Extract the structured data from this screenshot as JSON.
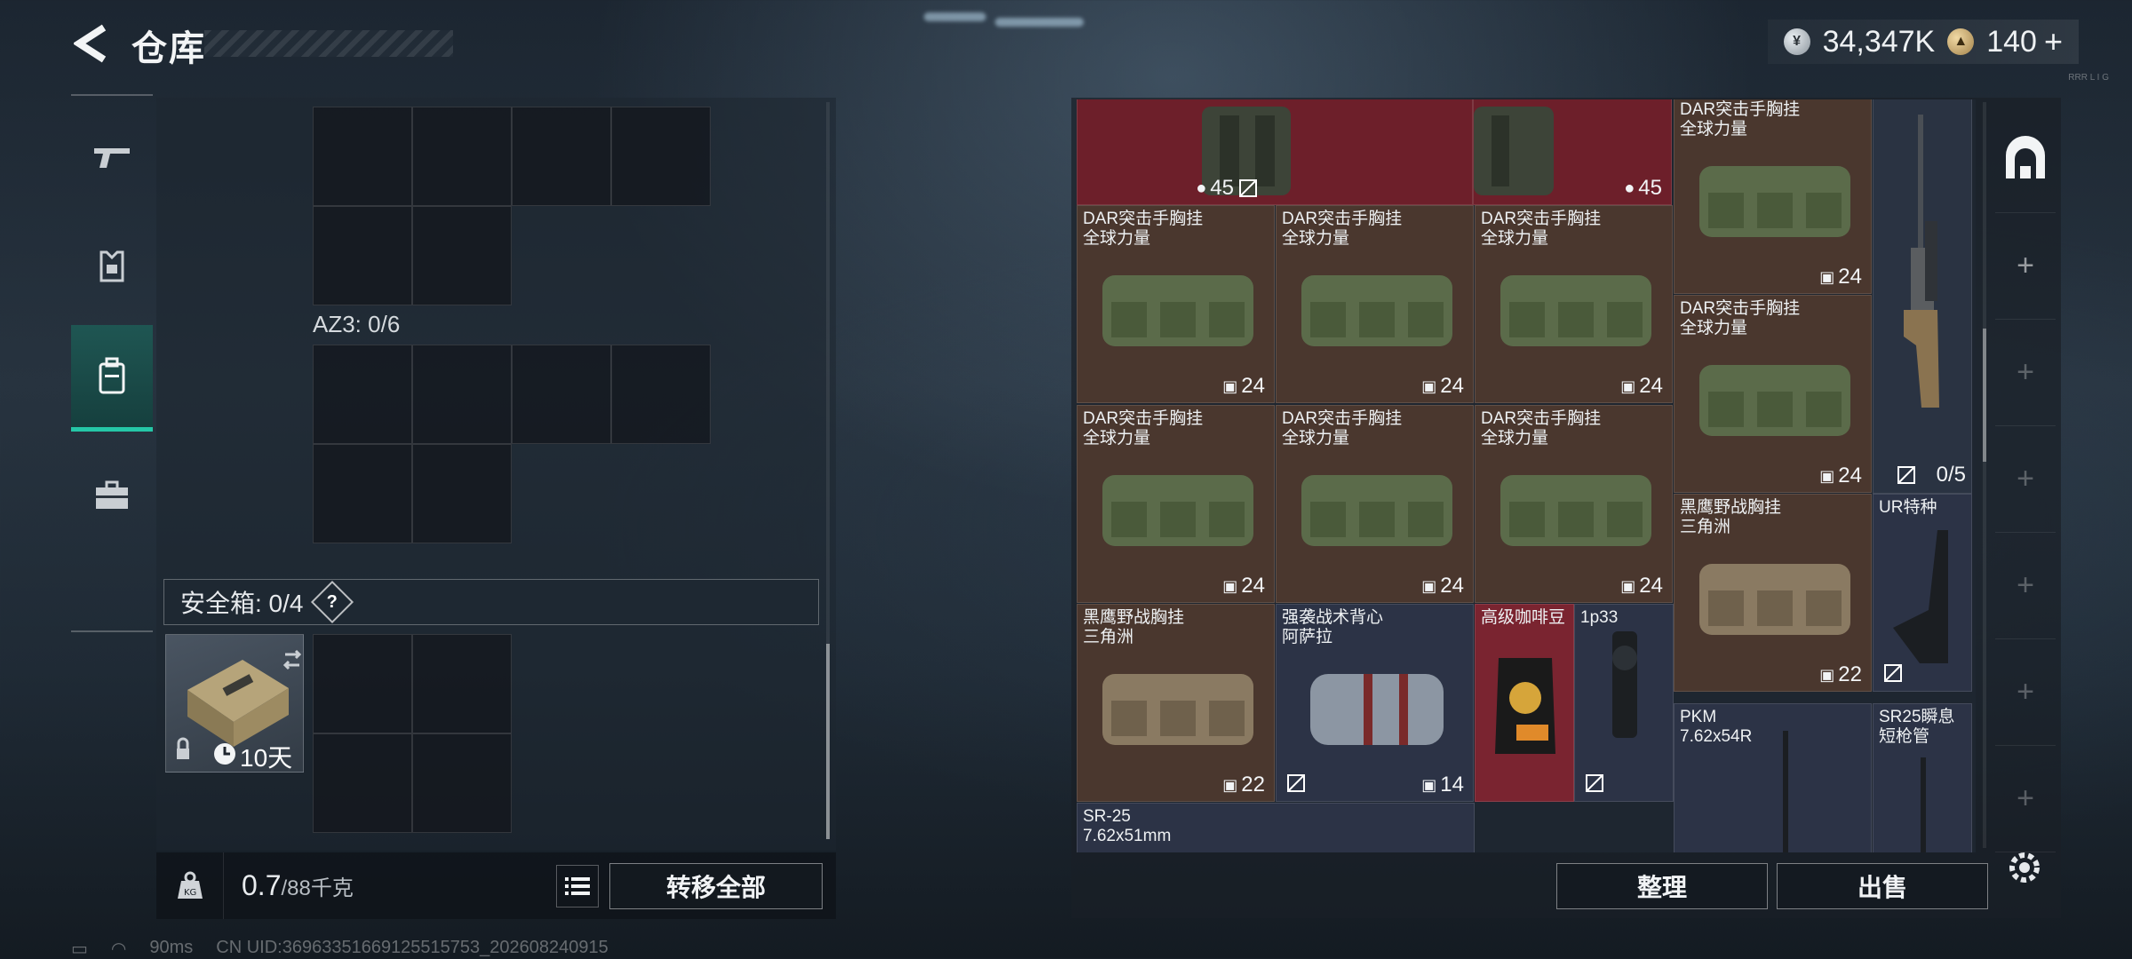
{
  "header": {
    "title": "仓库",
    "currency_silver": "34,347K",
    "currency_gold": "140",
    "plus_label": "+",
    "corner_code": "RRR L I G"
  },
  "left": {
    "az_label": "AZ3: 0/6",
    "safe_label": "安全箱: 0/4",
    "help_label": "?",
    "safebox_days": "10天",
    "weight_value": "0.7",
    "weight_capacity": "/88千克",
    "transfer_label": "转移全部"
  },
  "warehouse": {
    "top_count": "45",
    "items": [
      {
        "name": "DAR突击手胸挂\n全球力量",
        "count": "24"
      },
      {
        "name": "DAR突击手胸挂\n全球力量",
        "count": "24"
      },
      {
        "name": "DAR突击手胸挂\n全球力量",
        "count": "24"
      },
      {
        "name": "DAR突击手胸挂\n全球力量",
        "count": "24"
      },
      {
        "name": "DAR突击手胸挂\n全球力量",
        "count": "24"
      },
      {
        "name": "DAR突击手胸挂\n全球力量",
        "count": "24"
      },
      {
        "name": "DAR突击手胸挂\n全球力量",
        "count": "24"
      },
      {
        "name": "DAR突击手胸挂\n全球力量",
        "count": "24"
      },
      {
        "name": "黑鹰野战胸挂\n三角洲",
        "count": "22"
      },
      {
        "name": "强袭战术背心\n阿萨拉",
        "count": "14"
      },
      {
        "name": "高级咖啡豆",
        "count": ""
      },
      {
        "name": "1p33",
        "count": ""
      },
      {
        "name": "黑鹰野战胸挂\n三角洲",
        "count": "22"
      },
      {
        "name": "UR特种",
        "count": ""
      },
      {
        "name": "PKM\n7.62x54R",
        "count": ""
      },
      {
        "name": "SR25瞬息\n短枪管",
        "count": ""
      },
      {
        "name": "SR-25\n7.62x51mm",
        "count": ""
      }
    ],
    "rifle_slots": "0/5",
    "sort_label": "整理",
    "sell_label": "出售"
  },
  "status": {
    "ping": "90ms",
    "uid": "CN UID:36963351669125515753_202608240915"
  },
  "colors": {
    "accent": "#25c7a7",
    "wine": "#7a2430",
    "brown": "#4a372e",
    "navy": "#2c3346"
  }
}
